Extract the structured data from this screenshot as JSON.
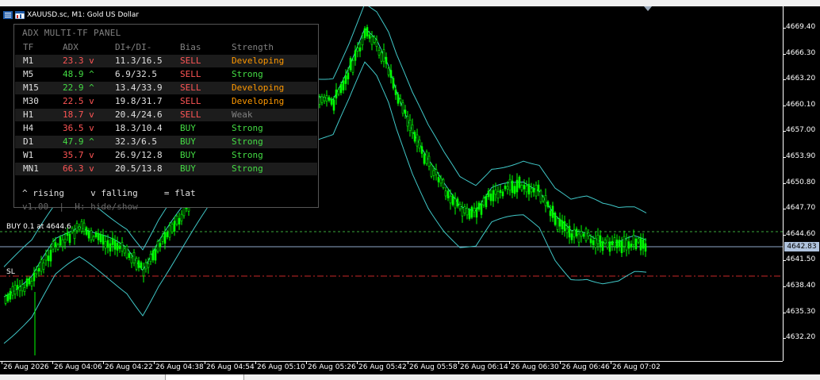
{
  "chart": {
    "title": "XAUUSD.sc, M1:  Gold US Dollar",
    "current_price": "4642.83",
    "price_labels": [
      "4669.40",
      "4666.30",
      "4663.20",
      "4660.10",
      "4657.00",
      "4653.90",
      "4650.80",
      "4647.70",
      "4644.60",
      "4641.50",
      "4638.40",
      "4635.30",
      "4632.20"
    ],
    "time_labels": [
      "26 Aug 2026",
      "26 Aug 04:06",
      "26 Aug 04:22",
      "26 Aug 04:38",
      "26 Aug 04:54",
      "26 Aug 05:10",
      "26 Aug 05:26",
      "26 Aug 05:42",
      "26 Aug 05:58",
      "26 Aug 06:14",
      "26 Aug 06:30",
      "26 Aug 06:46",
      "26 Aug 07:02"
    ],
    "buy_label": "BUY 0.1 at 4644.6",
    "sl_label": "SL",
    "colors": {
      "bull": "#00ff00",
      "bear": "#00ff00",
      "bands": "#40c8c8",
      "buy_line": "#3caa3c",
      "sl_line": "#c82828",
      "price_line": "#8fa8c8"
    }
  },
  "panel": {
    "title": "ADX MULTI-TF PANEL",
    "headers": [
      "TF",
      "ADX",
      "DI+/DI-",
      "Bias",
      "Strength"
    ],
    "rows": [
      {
        "tf": "M1",
        "adx": "23.3 v",
        "di": "11.3/16.5",
        "bias": "SELL",
        "strength": "Developing"
      },
      {
        "tf": "M5",
        "adx": "48.9 ^",
        "di": "6.9/32.5",
        "bias": "SELL",
        "strength": "Strong"
      },
      {
        "tf": "M15",
        "adx": "22.9 ^",
        "di": "13.4/33.9",
        "bias": "SELL",
        "strength": "Developing"
      },
      {
        "tf": "M30",
        "adx": "22.5 v",
        "di": "19.8/31.7",
        "bias": "SELL",
        "strength": "Developing"
      },
      {
        "tf": "H1",
        "adx": "18.7 v",
        "di": "20.4/24.6",
        "bias": "SELL",
        "strength": "Weak"
      },
      {
        "tf": "H4",
        "adx": "36.5 v",
        "di": "18.3/10.4",
        "bias": "BUY",
        "strength": "Strong"
      },
      {
        "tf": "D1",
        "adx": "47.9 ^",
        "di": "32.3/6.5",
        "bias": "BUY",
        "strength": "Strong"
      },
      {
        "tf": "W1",
        "adx": "35.7 v",
        "di": "26.9/12.8",
        "bias": "BUY",
        "strength": "Strong"
      },
      {
        "tf": "MN1",
        "adx": "66.3 v",
        "di": "20.5/13.8",
        "bias": "BUY",
        "strength": "Strong"
      }
    ],
    "row_colors": [
      {
        "adx": "#ff5555",
        "bias": "#ff5555",
        "strength": "#ff9900"
      },
      {
        "adx": "#44dd44",
        "bias": "#ff5555",
        "strength": "#44dd44"
      },
      {
        "adx": "#44dd44",
        "bias": "#ff5555",
        "strength": "#ff9900"
      },
      {
        "adx": "#ff5555",
        "bias": "#ff5555",
        "strength": "#ff9900"
      },
      {
        "adx": "#ff5555",
        "bias": "#ff5555",
        "strength": "#808080"
      },
      {
        "adx": "#ff5555",
        "bias": "#44dd44",
        "strength": "#44dd44"
      },
      {
        "adx": "#44dd44",
        "bias": "#44dd44",
        "strength": "#44dd44"
      },
      {
        "adx": "#ff5555",
        "bias": "#44dd44",
        "strength": "#44dd44"
      },
      {
        "adx": "#ff5555",
        "bias": "#44dd44",
        "strength": "#44dd44"
      }
    ],
    "legend_rising": "^ rising",
    "legend_falling": "v falling",
    "legend_flat": "= flat",
    "version": "v1.00",
    "separator": "|",
    "hint": "H: hide/show"
  }
}
